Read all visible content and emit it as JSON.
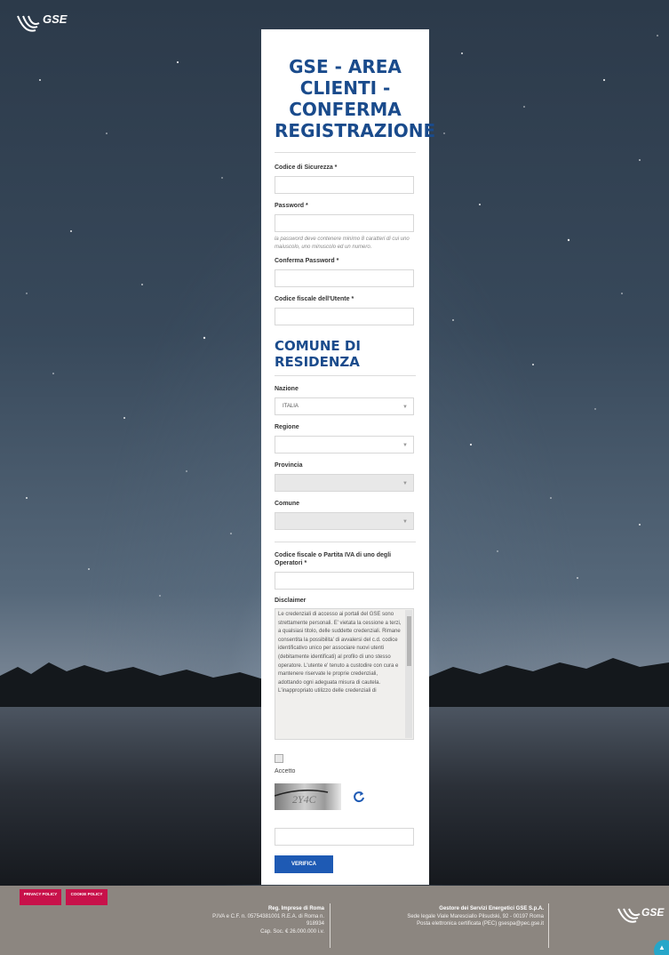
{
  "header": {
    "logo_text": "GSE"
  },
  "form": {
    "title": "GSE - AREA CLIENTI - CONFERMA REGISTRAZIONE",
    "codice_sicurezza_label": "Codice di Sicurezza *",
    "password_label": "Password *",
    "password_hint": "la password deve contenere minimo 8 caratteri di cui uno maiuscolo, uno minuscolo ed un numero.",
    "conferma_password_label": "Conferma Password *",
    "codice_fiscale_utente_label": "Codice fiscale dell'Utente *",
    "section_comune": "COMUNE DI RESIDENZA",
    "nazione_label": "Nazione",
    "nazione_value": "ITALIA",
    "regione_label": "Regione",
    "regione_value": "",
    "provincia_label": "Provincia",
    "provincia_value": "",
    "comune_label": "Comune",
    "comune_value": "",
    "operatori_label": "Codice fiscale o Partita IVA di uno degli Operatori *",
    "disclaimer_label": "Disclaimer",
    "disclaimer_text": "Le credenziali di accesso ai portali del GSE sono strettamente personali. E' vietata la cessione a terzi, a qualsiasi titolo, delle suddette credenziali. Rimane consentita la possibilita' di avvalersi del c.d. codice identificativo unico per associare nuovi utenti (debitamente identificati) al profilo di uno stesso operatore. L'utente e' tenuto a custodire con cura e mantenere riservate le proprie credenziali, adottando ogni adeguata misura di cautela. L'inappropriato utilizzo delle credenziali di",
    "accetto_label": "Accetto",
    "captcha_text": "2Y4C",
    "verifica_button": "VERIFICA"
  },
  "footer": {
    "privacy_policy": "PRIVACY POLICY",
    "cookie_policy": "COOKIE POLICY",
    "reg_title": "Reg. Imprese di Roma",
    "reg_line1": "P.IVA e C.F. n. 05754381001 R.E.A. di Roma n.",
    "reg_line2": "918934",
    "reg_line3": "Cap. Soc. € 26.000.000 i.v.",
    "company_title": "Gestore dei Servizi Energetici GSE S.p.A.",
    "company_line1": "Sede legale Viale Maresciallo Pilsudski, 92 - 00197 Roma",
    "company_line2": "Posta elettronica certificata (PEC) gsespa@pec.gse.it",
    "logo_text": "GSE"
  },
  "colors": {
    "primary": "#1a4b8c",
    "button": "#1e5ab4",
    "pill": "#c8114a",
    "footer": "#8c8680"
  }
}
